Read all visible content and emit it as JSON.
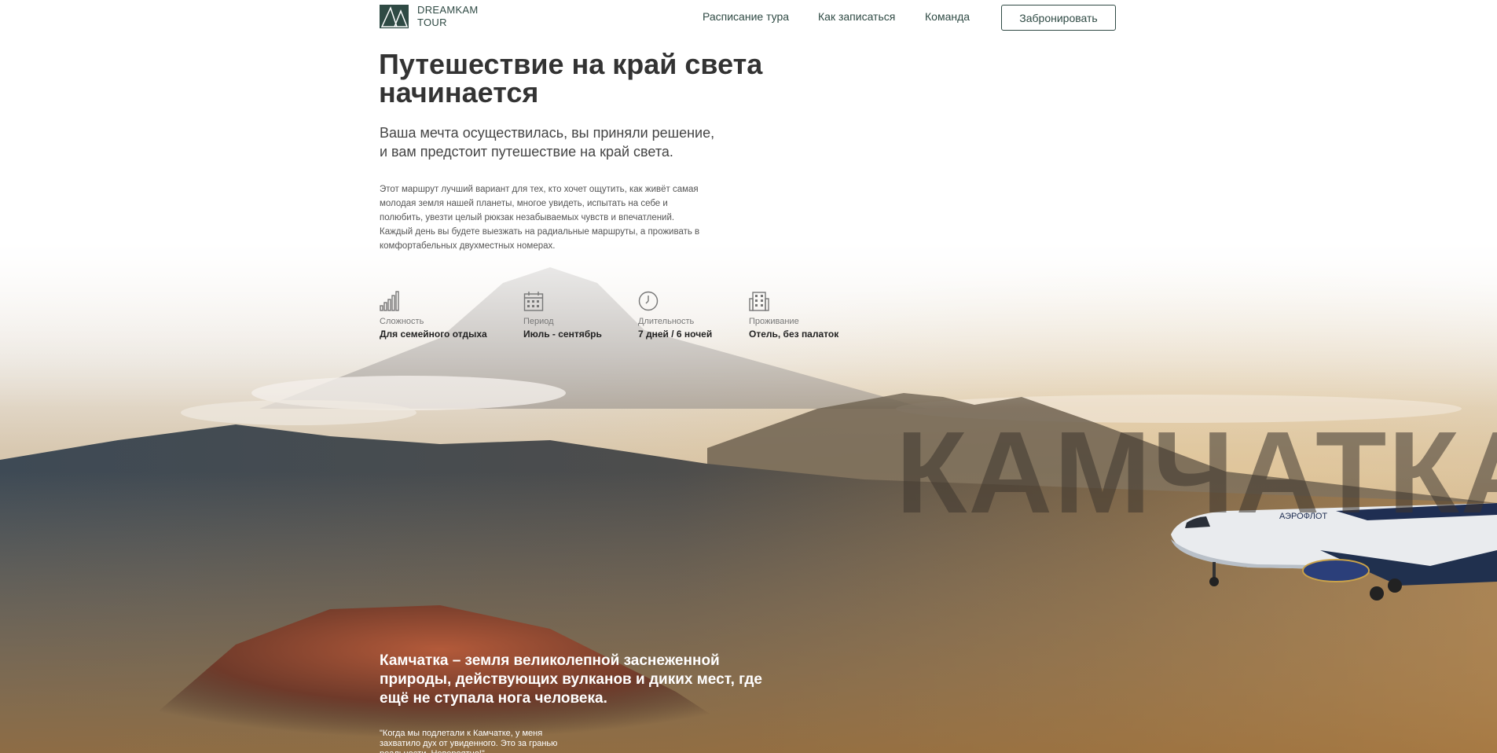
{
  "header": {
    "logo_line1": "DREAMKAM",
    "logo_line2": "TOUR",
    "nav": [
      "Расписание тура",
      "Как записаться",
      "Команда"
    ],
    "book_label": "Забронировать"
  },
  "hero": {
    "title": "Путешествие на край света начинается",
    "subtitle_line1": "Ваша мечта осуществилась, вы приняли решение,",
    "subtitle_line2": "и вам предстоит путешествие на край света.",
    "description": [
      "Этот маршрут лучший вариант для тех, кто хочет ощутить, как живёт самая",
      "молодая земля нашей планеты, многое увидеть, испытать на себе и",
      "полюбить, увезти целый рюкзак незабываемых чувств и впечатлений.",
      "Каждый день вы будете выезжать на радиальные маршруты, а проживать в",
      "комфортабельных двухместных номерах."
    ]
  },
  "features": [
    {
      "icon": "difficulty-bars-icon",
      "label": "Сложность",
      "value": "Для семейного отдыха"
    },
    {
      "icon": "calendar-icon",
      "label": "Период",
      "value": "Июль - сентябрь"
    },
    {
      "icon": "clock-icon",
      "label": "Длительность",
      "value": "7 дней / 6 ночей"
    },
    {
      "icon": "building-icon",
      "label": "Проживание",
      "value": "Отель, без палаток"
    }
  ],
  "watermark_word": "КАМЧАТКА",
  "bottom": {
    "title": "Камчатка – земля великолепной заснеженной природы, действующих вулканов и диких мест, где ещё не ступала нога человека.",
    "quote": "\"Когда мы подлетали к Камчатке, у меня захватило дух от увиденного. Это за гранью реальности. Невероятно!\""
  },
  "plane_livery": "АЭРОФЛОТ",
  "colors": {
    "brand": "#2f4a44",
    "text_dark": "#333333"
  }
}
